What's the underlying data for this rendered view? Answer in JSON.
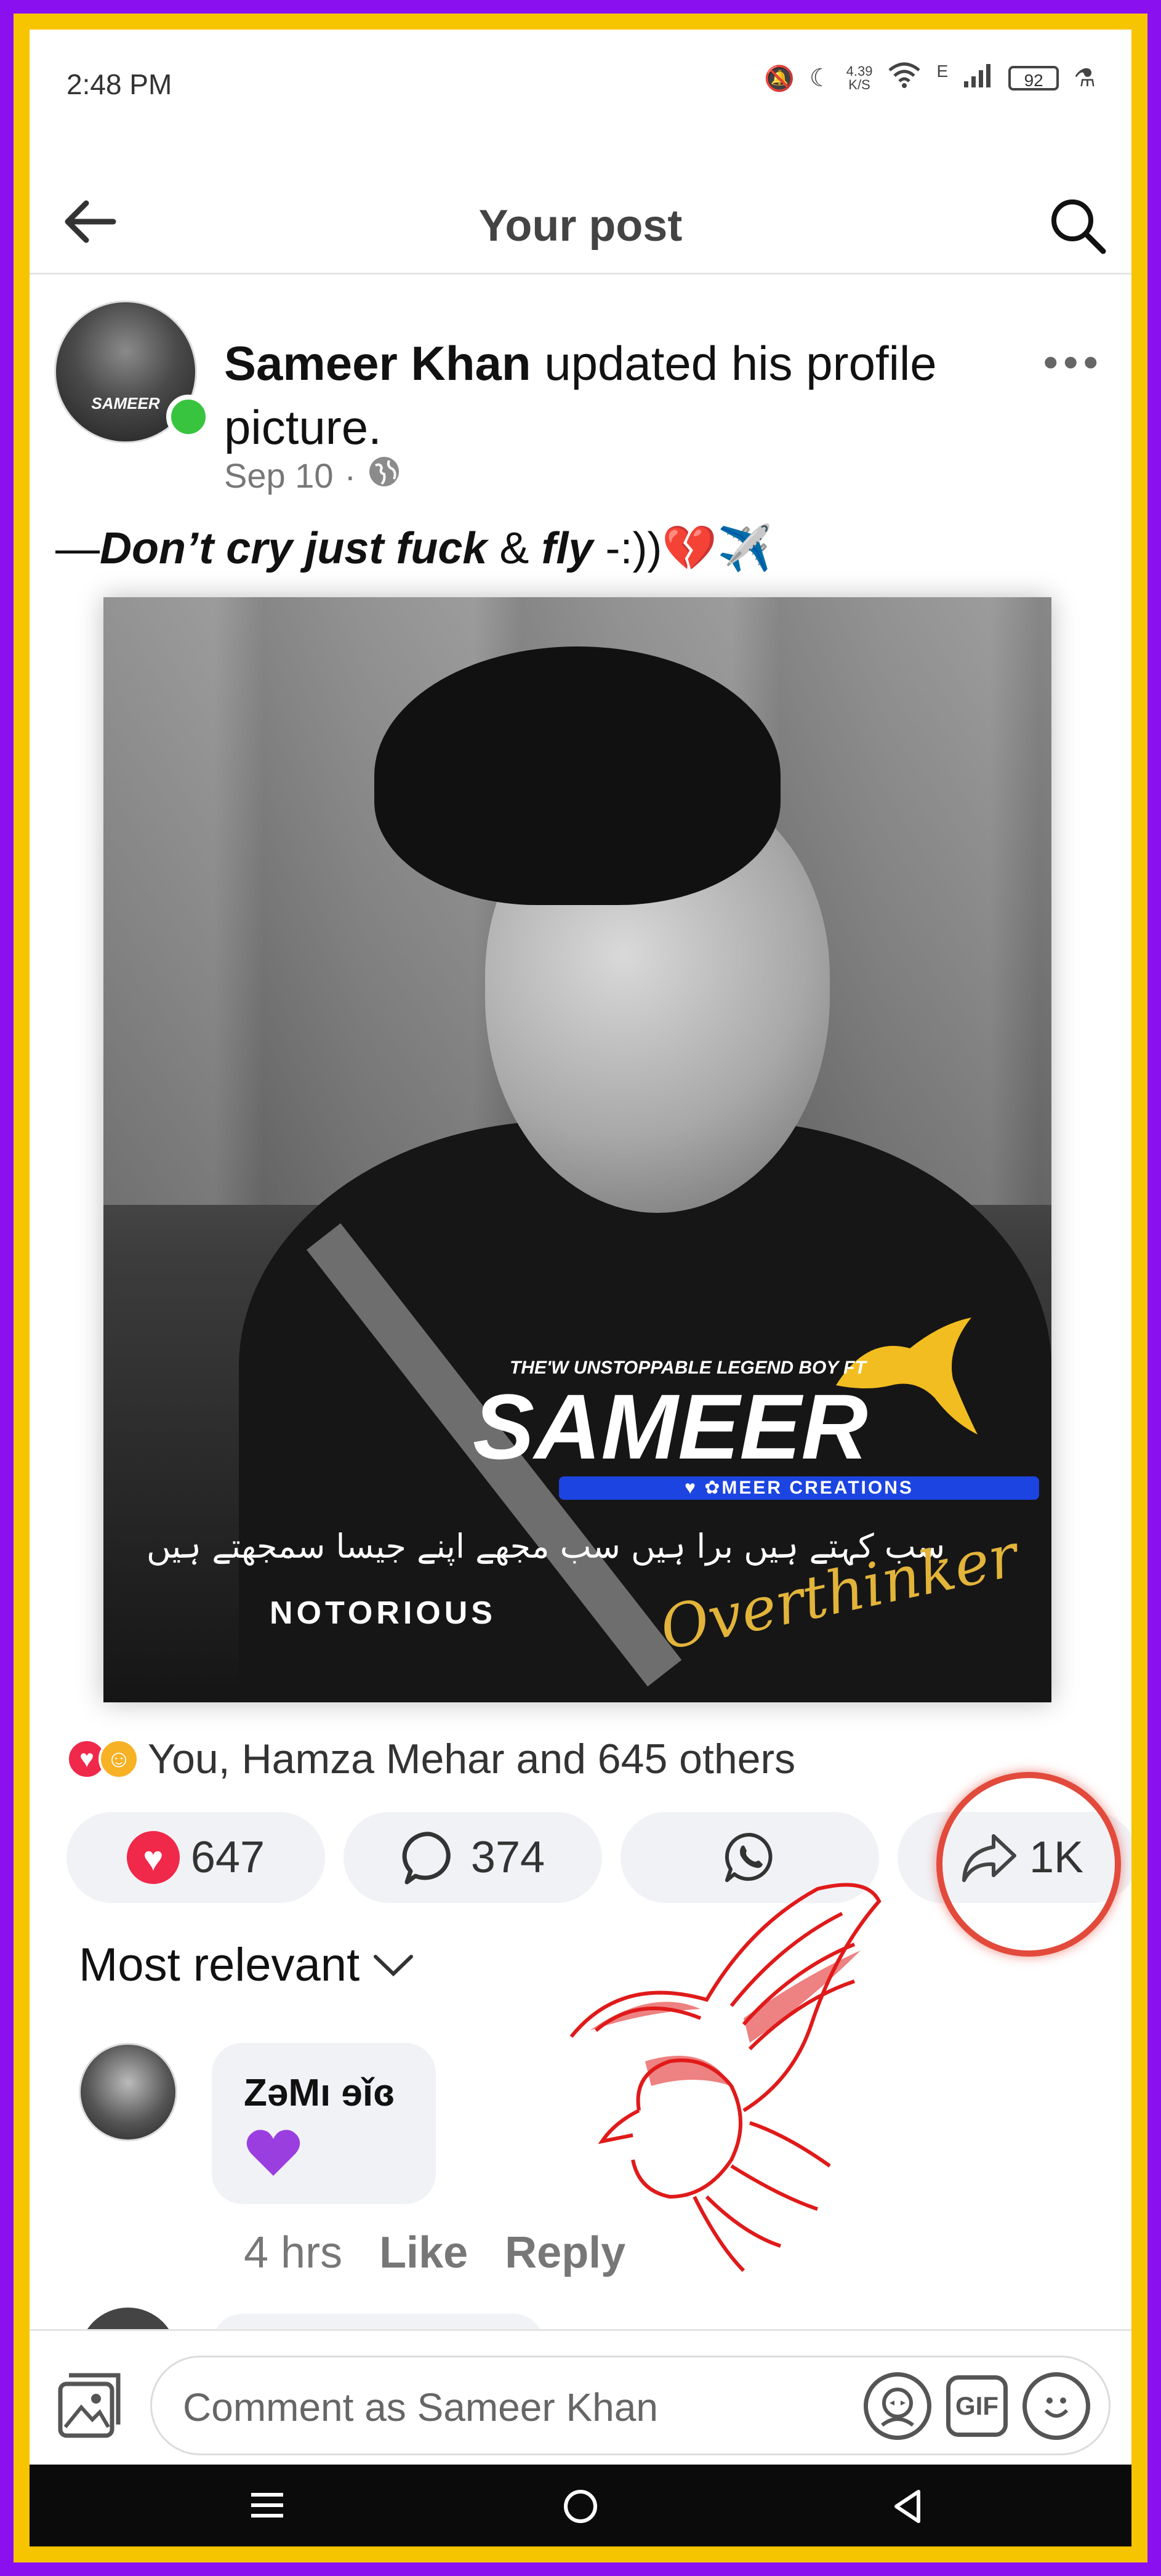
{
  "status_bar": {
    "time": "2:48 PM",
    "net_speed_value": "4.39",
    "net_speed_unit": "K/S",
    "network": "E",
    "battery": "92"
  },
  "header": {
    "title": "Your post"
  },
  "post": {
    "author": "Sameer Khan",
    "action": " updated his profile picture.",
    "date": "Sep 10",
    "separator": "·",
    "caption_dash": "—",
    "caption_bold1": "Don’t cry just fuck",
    "caption_amp": " & ",
    "caption_bold2": "fly",
    "caption_tail": " -:))💔✈️",
    "avatar_text": "SAMEER"
  },
  "photo_text": {
    "line1": "THE'W UNSTOPPABLE LEGEND BOY FT",
    "line2": "SAMEER",
    "band": "♥ ✿MEER CREATIONS",
    "urdu": "سب کہتے ہیں برا ہیں سب مجھے اپنے جیسا سمجھتے ہیں",
    "notorious": "NOTORIOUS",
    "signature": "Overthinker"
  },
  "reactions": {
    "summary": "You, Hamza Mehar and 645 others",
    "like_count": "647",
    "comment_count": "374",
    "share_count": "1K"
  },
  "comments": {
    "sort_label": "Most relevant",
    "first": {
      "name": "ZəMı ɘǐɞ",
      "time": "4 hrs",
      "like": "Like",
      "reply": "Reply"
    }
  },
  "composer": {
    "placeholder": "Comment as Sameer Khan",
    "gif_label": "GIF"
  },
  "colors": {
    "frame_outer": "#8b10f0",
    "frame_inner": "#f7c400",
    "heart": "#f0284a",
    "mark": "#e24a3b"
  }
}
